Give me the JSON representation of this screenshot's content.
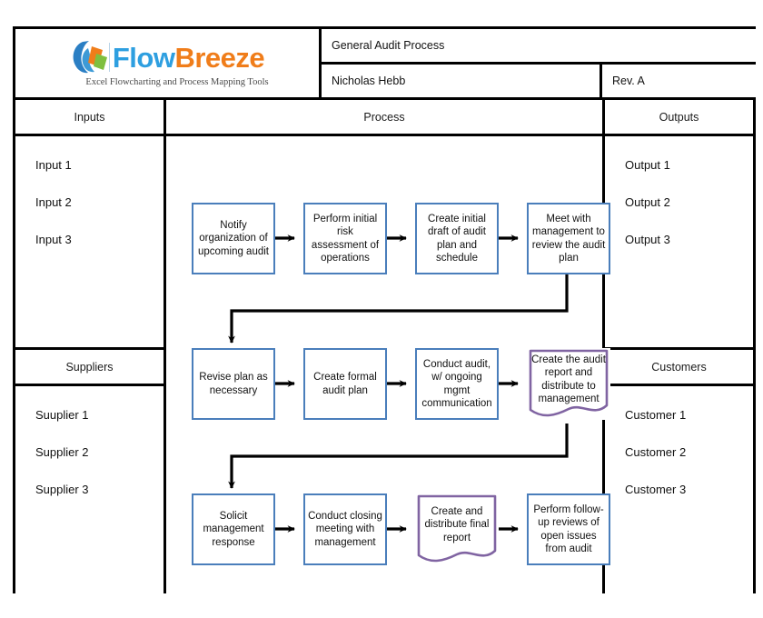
{
  "logo": {
    "word_part1": "Flow",
    "word_part2": "Breeze",
    "tagline": "Excel Flowcharting and Process Mapping Tools",
    "colors": {
      "flow": "#2e9fe0",
      "breeze": "#f07d1a",
      "leaf_green": "#7fbf3f"
    }
  },
  "header": {
    "title": "General Audit Process",
    "author": "Nicholas Hebb",
    "revision": "Rev. A"
  },
  "columns": {
    "inputs_label": "Inputs",
    "process_label": "Process",
    "outputs_label": "Outputs",
    "suppliers_label": "Suppliers",
    "customers_label": "Customers"
  },
  "inputs": [
    "Input 1",
    "Input 2",
    "Input 3"
  ],
  "outputs": [
    "Output 1",
    "Output 2",
    "Output 3"
  ],
  "suppliers": [
    "Suuplier 1",
    "Supplier 2",
    "Supplier 3"
  ],
  "customers": [
    "Customer 1",
    "Customer 2",
    "Customer 3"
  ],
  "colors": {
    "process_border": "#4a7ebb",
    "document_border": "#8064a2",
    "frame": "#000000",
    "connector": "#000000"
  },
  "chart_data": {
    "type": "diagram",
    "title": "General Audit Process",
    "diagram_kind": "SIPOC cross-functional flowchart",
    "rows": 3,
    "nodes": [
      {
        "id": "n1",
        "row": 1,
        "col": 1,
        "shape": "process",
        "text": "Notify organization of upcoming audit"
      },
      {
        "id": "n2",
        "row": 1,
        "col": 2,
        "shape": "process",
        "text": "Perform initial risk assessment of operations"
      },
      {
        "id": "n3",
        "row": 1,
        "col": 3,
        "shape": "process",
        "text": "Create initial draft of audit plan and schedule"
      },
      {
        "id": "n4",
        "row": 1,
        "col": 4,
        "shape": "process",
        "text": "Meet with management to review the audit plan"
      },
      {
        "id": "n5",
        "row": 2,
        "col": 1,
        "shape": "process",
        "text": "Revise plan as necessary"
      },
      {
        "id": "n6",
        "row": 2,
        "col": 2,
        "shape": "process",
        "text": "Create formal audit plan"
      },
      {
        "id": "n7",
        "row": 2,
        "col": 3,
        "shape": "process",
        "text": "Conduct audit, w/ ongoing mgmt communication"
      },
      {
        "id": "n8",
        "row": 2,
        "col": 4,
        "shape": "document",
        "text": "Create the audit report and distribute to management"
      },
      {
        "id": "n9",
        "row": 3,
        "col": 1,
        "shape": "process",
        "text": "Solicit management response"
      },
      {
        "id": "n10",
        "row": 3,
        "col": 2,
        "shape": "process",
        "text": "Conduct closing meeting with management"
      },
      {
        "id": "n11",
        "row": 3,
        "col": 3,
        "shape": "document",
        "text": "Create and distribute final report"
      },
      {
        "id": "n12",
        "row": 3,
        "col": 4,
        "shape": "process",
        "text": "Perform follow-up reviews of open issues from audit"
      }
    ],
    "edges": [
      {
        "from": "n1",
        "to": "n2",
        "kind": "straight"
      },
      {
        "from": "n2",
        "to": "n3",
        "kind": "straight"
      },
      {
        "from": "n3",
        "to": "n4",
        "kind": "straight"
      },
      {
        "from": "n4",
        "to": "n5",
        "kind": "wrap"
      },
      {
        "from": "n5",
        "to": "n6",
        "kind": "straight"
      },
      {
        "from": "n6",
        "to": "n7",
        "kind": "straight"
      },
      {
        "from": "n7",
        "to": "n8",
        "kind": "straight"
      },
      {
        "from": "n8",
        "to": "n9",
        "kind": "wrap"
      },
      {
        "from": "n9",
        "to": "n10",
        "kind": "straight"
      },
      {
        "from": "n10",
        "to": "n11",
        "kind": "straight"
      },
      {
        "from": "n11",
        "to": "n12",
        "kind": "straight"
      }
    ]
  }
}
